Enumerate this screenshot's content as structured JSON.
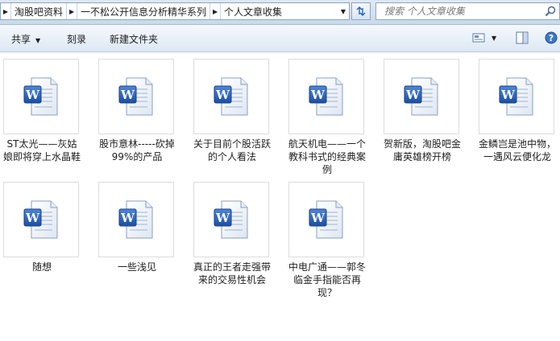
{
  "address": {
    "crumbs": [
      "淘股吧资料",
      "一不松公开信息分析精华系列",
      "个人文章收集"
    ]
  },
  "search": {
    "placeholder": "搜索 个人文章收集"
  },
  "toolbar": {
    "share_label": "共享",
    "burn_label": "刻录",
    "new_folder_label": "新建文件夹"
  },
  "colors": {
    "word_blue": "#1e56b3",
    "header_bg": "#dde8f4"
  },
  "files": [
    {
      "name": "ST太光——灰姑娘即将穿上水晶鞋",
      "icon": "word-doc-icon"
    },
    {
      "name": "股市意林-----砍掉99%的产品",
      "icon": "word-doc-icon"
    },
    {
      "name": "关于目前个股活跃的个人看法",
      "icon": "word-doc-icon"
    },
    {
      "name": "航天机电——一个教科书式的经典案例",
      "icon": "word-doc-icon"
    },
    {
      "name": "贺新版，淘股吧金庸英雄榜开榜",
      "icon": "word-doc-icon"
    },
    {
      "name": "金鳞岂是池中物，一遇风云便化龙",
      "icon": "word-doc-icon"
    },
    {
      "name": "随想",
      "icon": "word-doc-icon"
    },
    {
      "name": "一些浅见",
      "icon": "word-doc-icon"
    },
    {
      "name": "真正的王者走强带来的交易性机会",
      "icon": "word-doc-icon"
    },
    {
      "name": "中电广通——郭冬临金手指能否再现？",
      "icon": "word-doc-icon"
    }
  ]
}
